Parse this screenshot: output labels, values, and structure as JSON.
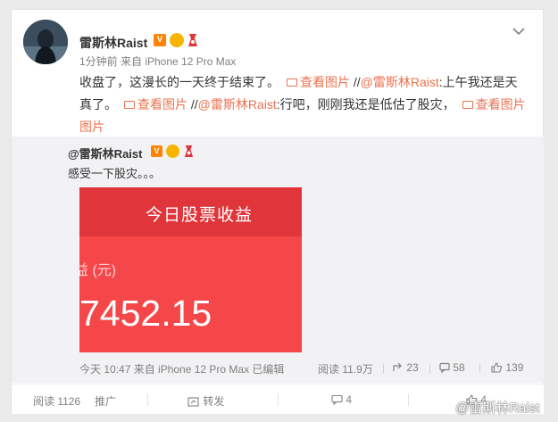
{
  "post": {
    "username": "雷斯林Raist",
    "verified_badge": "V",
    "meta": "1分钟前 来自 iPhone 12 Pro Max",
    "text_1": "收盘了，这漫长的一天终于结束了。",
    "view_pic_label": "查看图片",
    "sep": " //",
    "mention": "@雷斯林Raist",
    "text_2": ":上午我还是天",
    "text_3": "真了。",
    "text_4": ":行吧，刚刚我还是低估了股灾，",
    "view_pic_last": "图片"
  },
  "repost": {
    "username": "@雷斯林Raist",
    "verified_badge": "V",
    "text": "感受一下股灾。。。",
    "image": {
      "title": "今日股票收益",
      "label": "益 (元)",
      "value": "7452.15"
    },
    "meta": "今天 10:47 来自 iPhone 12 Pro Max  已编辑",
    "reads": "阅读 11.9万",
    "reposts": "23",
    "comments": "58",
    "likes": "139"
  },
  "footer": {
    "reads": "阅读 1126",
    "promote": "推广",
    "forward": "转发",
    "comments": "4",
    "likes": "4"
  },
  "watermark": "@雷斯林Raist"
}
